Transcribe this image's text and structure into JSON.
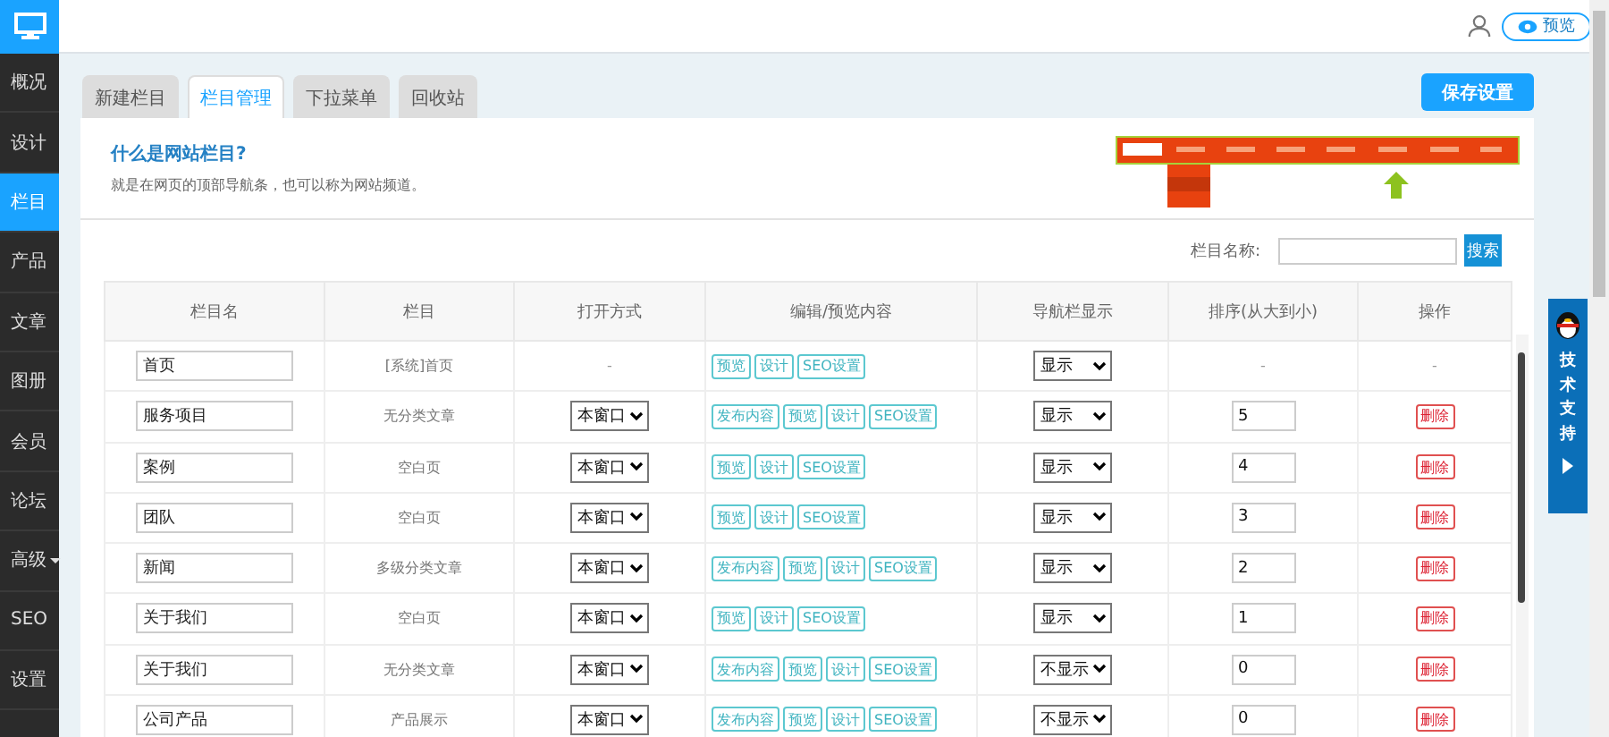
{
  "sidebar": {
    "items": [
      {
        "label": "概况",
        "selected": false
      },
      {
        "label": "设计",
        "selected": false
      },
      {
        "label": "栏目",
        "selected": true
      },
      {
        "label": "产品",
        "selected": false
      },
      {
        "label": "文章",
        "selected": false
      },
      {
        "label": "图册",
        "selected": false
      },
      {
        "label": "会员",
        "selected": false
      },
      {
        "label": "论坛",
        "selected": false
      },
      {
        "label": "高级",
        "selected": false,
        "dropdown": true
      },
      {
        "label": "SEO",
        "selected": false
      },
      {
        "label": "设置",
        "selected": false
      }
    ]
  },
  "topbar": {
    "preview_button": "预览"
  },
  "tabs": [
    {
      "label": "新建栏目",
      "selected": false
    },
    {
      "label": "栏目管理",
      "selected": true
    },
    {
      "label": "下拉菜单",
      "selected": false
    },
    {
      "label": "回收站",
      "selected": false
    }
  ],
  "save_button": "保存设置",
  "info": {
    "title": "什么是网站栏目?",
    "description": "就是在网页的顶部导航条，也可以称为网站频道。"
  },
  "search": {
    "label": "栏目名称:",
    "button": "搜索"
  },
  "table": {
    "columns": [
      "栏目名",
      "栏目",
      "打开方式",
      "编辑/预览内容",
      "导航栏显示",
      "排序(从大到小)",
      "操作"
    ],
    "rows": [
      {
        "name": "首页",
        "type": "[系统]首页",
        "open": {
          "kind": "text",
          "value": "-"
        },
        "actions": [
          "预览",
          "设计",
          "SEO设置"
        ],
        "nav": "显示",
        "sort": {
          "kind": "text",
          "value": "-"
        },
        "operation": {
          "kind": "text",
          "value": "-"
        }
      },
      {
        "name": "服务项目",
        "type": "无分类文章",
        "open": {
          "kind": "select",
          "value": "本窗口"
        },
        "actions": [
          "发布内容",
          "预览",
          "设计",
          "SEO设置"
        ],
        "nav": "显示",
        "sort": {
          "kind": "input",
          "value": "5"
        },
        "operation": {
          "kind": "button",
          "value": "删除"
        }
      },
      {
        "name": "案例",
        "type": "空白页",
        "open": {
          "kind": "select",
          "value": "本窗口"
        },
        "actions": [
          "预览",
          "设计",
          "SEO设置"
        ],
        "nav": "显示",
        "sort": {
          "kind": "input",
          "value": "4"
        },
        "operation": {
          "kind": "button",
          "value": "删除"
        }
      },
      {
        "name": "团队",
        "type": "空白页",
        "open": {
          "kind": "select",
          "value": "本窗口"
        },
        "actions": [
          "预览",
          "设计",
          "SEO设置"
        ],
        "nav": "显示",
        "sort": {
          "kind": "input",
          "value": "3"
        },
        "operation": {
          "kind": "button",
          "value": "删除"
        }
      },
      {
        "name": "新闻",
        "type": "多级分类文章",
        "open": {
          "kind": "select",
          "value": "本窗口"
        },
        "actions": [
          "发布内容",
          "预览",
          "设计",
          "SEO设置"
        ],
        "nav": "显示",
        "sort": {
          "kind": "input",
          "value": "2"
        },
        "operation": {
          "kind": "button",
          "value": "删除"
        }
      },
      {
        "name": "关于我们",
        "type": "空白页",
        "open": {
          "kind": "select",
          "value": "本窗口"
        },
        "actions": [
          "预览",
          "设计",
          "SEO设置"
        ],
        "nav": "显示",
        "sort": {
          "kind": "input",
          "value": "1"
        },
        "operation": {
          "kind": "button",
          "value": "删除"
        }
      },
      {
        "name": "关于我们",
        "type": "无分类文章",
        "open": {
          "kind": "select",
          "value": "本窗口"
        },
        "actions": [
          "发布内容",
          "预览",
          "设计",
          "SEO设置"
        ],
        "nav": "不显示",
        "sort": {
          "kind": "input",
          "value": "0"
        },
        "operation": {
          "kind": "button",
          "value": "删除"
        }
      },
      {
        "name": "公司产品",
        "type": "产品展示",
        "open": {
          "kind": "select",
          "value": "本窗口"
        },
        "actions": [
          "发布内容",
          "预览",
          "设计",
          "SEO设置"
        ],
        "nav": "不显示",
        "sort": {
          "kind": "input",
          "value": "0"
        },
        "operation": {
          "kind": "button",
          "value": "删除"
        }
      }
    ]
  },
  "support": {
    "label": "技术支持"
  }
}
